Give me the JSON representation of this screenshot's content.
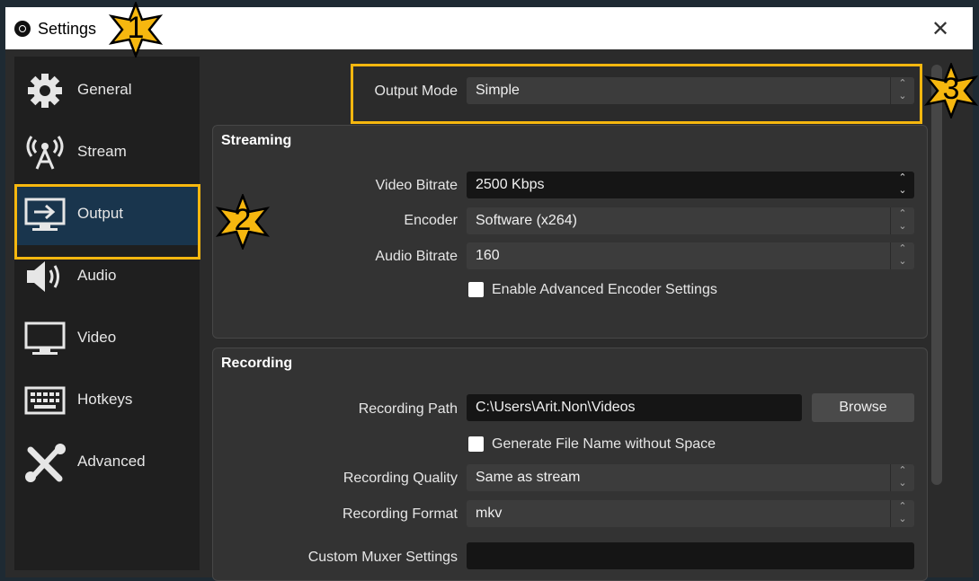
{
  "window": {
    "title": "Settings",
    "close_glyph": "✕"
  },
  "sidebar": {
    "items": [
      {
        "label": "General",
        "icon": "gear-icon"
      },
      {
        "label": "Stream",
        "icon": "broadcast-icon"
      },
      {
        "label": "Output",
        "icon": "output-monitor-icon",
        "selected": true
      },
      {
        "label": "Audio",
        "icon": "speaker-icon"
      },
      {
        "label": "Video",
        "icon": "monitor-icon"
      },
      {
        "label": "Hotkeys",
        "icon": "keyboard-icon"
      },
      {
        "label": "Advanced",
        "icon": "tools-icon"
      }
    ]
  },
  "output_mode": {
    "label": "Output Mode",
    "value": "Simple"
  },
  "streaming": {
    "title": "Streaming",
    "video_bitrate": {
      "label": "Video Bitrate",
      "value": "2500 Kbps"
    },
    "encoder": {
      "label": "Encoder",
      "value": "Software (x264)"
    },
    "audio_bitrate": {
      "label": "Audio Bitrate",
      "value": "160"
    },
    "advanced_encoder": {
      "label": "Enable Advanced Encoder Settings",
      "checked": false
    }
  },
  "recording": {
    "title": "Recording",
    "path": {
      "label": "Recording Path",
      "value": "C:\\Users\\Arit.Non\\Videos"
    },
    "browse_label": "Browse",
    "no_space": {
      "label": "Generate File Name without Space",
      "checked": false
    },
    "quality": {
      "label": "Recording Quality",
      "value": "Same as stream"
    },
    "format": {
      "label": "Recording Format",
      "value": "mkv"
    },
    "muxer": {
      "label": "Custom Muxer Settings",
      "value": ""
    }
  },
  "annotations": [
    {
      "number": "1"
    },
    {
      "number": "2"
    },
    {
      "number": "3"
    }
  ],
  "colors": {
    "highlight": "#f6b70f",
    "selected_bg": "#19354d",
    "panel_bg": "#2b2b2b"
  }
}
